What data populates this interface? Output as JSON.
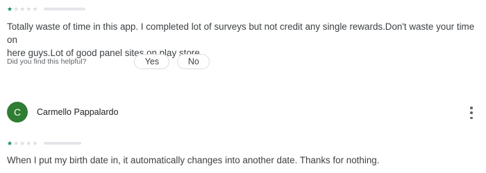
{
  "reviews": [
    {
      "stars_filled": 1,
      "stars_total": 5,
      "text": "Totally waste of time in this app. I completed lot of surveys but not credit any single rewards.Don't waste your time on\nhere guys.Lot of good panel sites on play store."
    },
    {
      "reviewer_initial": "C",
      "reviewer_name": "Carmello Pappalardo",
      "stars_filled": 1,
      "stars_total": 5,
      "text": "When I put my birth date in, it automatically changes into another date. Thanks for nothing."
    }
  ],
  "helpful": {
    "question": "Did you find this helpful?",
    "yes_label": "Yes",
    "no_label": "No"
  },
  "icons": {
    "star": "star-icon",
    "menu": "more-vert-icon"
  },
  "colors": {
    "star_filled": "#01875f",
    "star_empty": "#dadce0",
    "avatar_bg": "#2e7d32"
  }
}
